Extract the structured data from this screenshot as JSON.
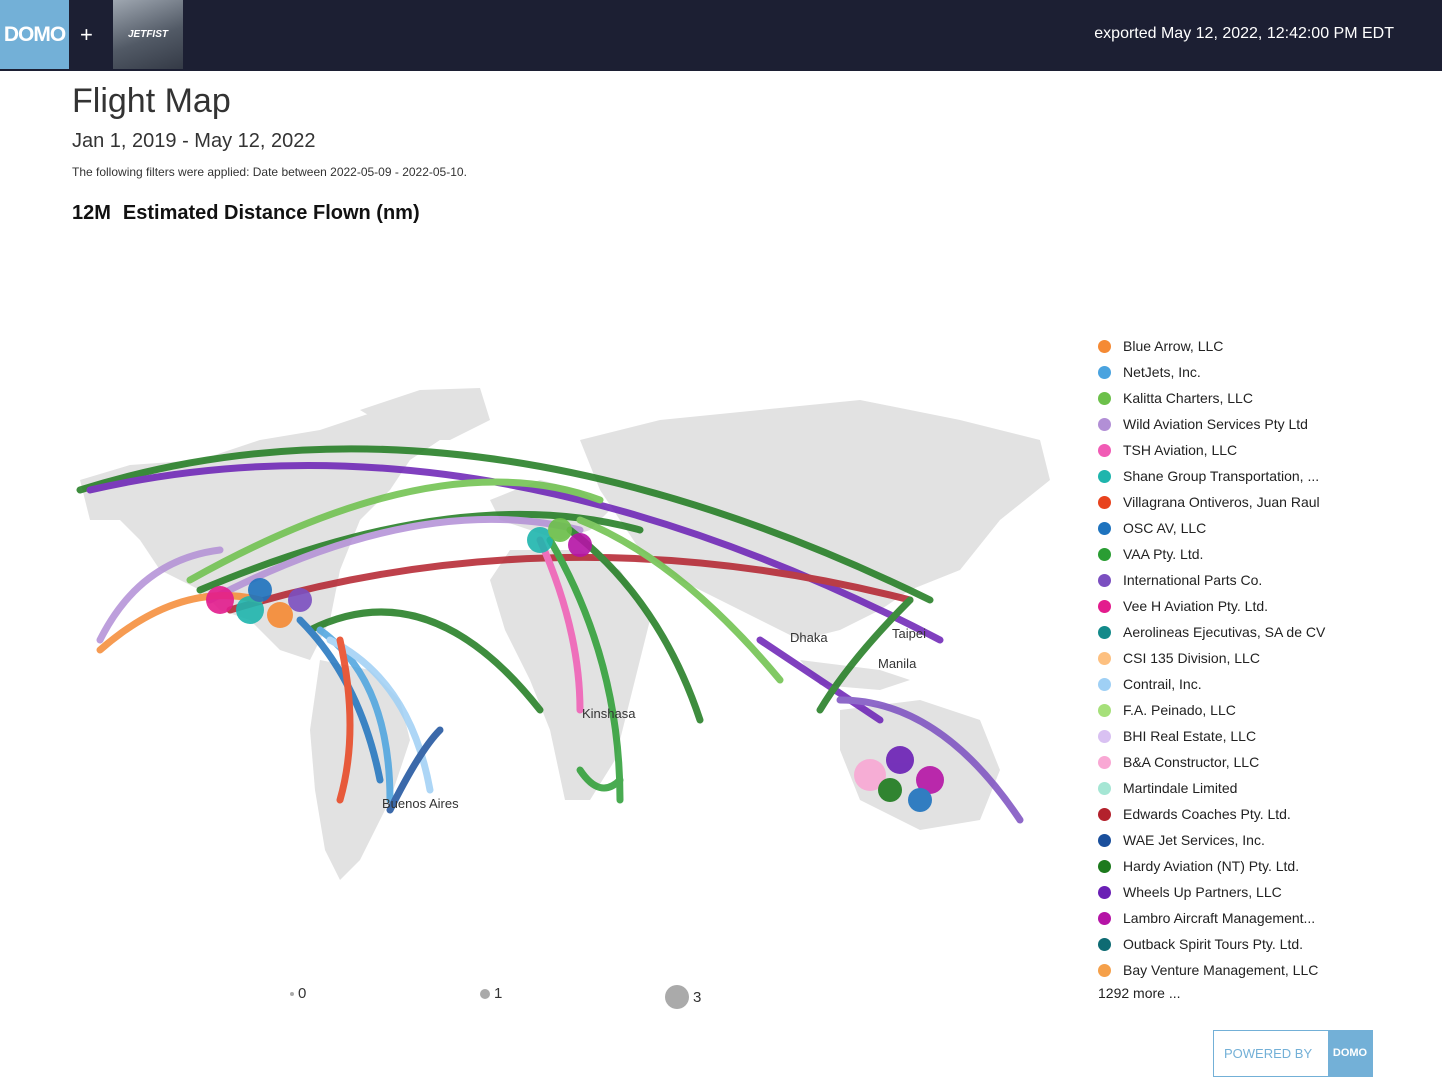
{
  "header": {
    "brand": "DOMO",
    "plus": "+",
    "partner_logo_text": "JETFIST",
    "exported_label": "exported May 12, 2022, 12:42:00 PM EDT"
  },
  "page": {
    "title": "Flight Map",
    "date_range": "Jan 1, 2019 - May 12, 2022",
    "filters_note": "The following filters were applied: Date between 2022-05-09 - 2022-05-10.",
    "summary_value": "12M",
    "summary_label": "Estimated Distance Flown (nm)"
  },
  "map": {
    "city_labels": [
      "Kinshasa",
      "Buenos Aires",
      "Dhaka",
      "Taipei",
      "Manila"
    ]
  },
  "legend": {
    "items": [
      {
        "label": "Blue Arrow, LLC",
        "color": "#f58a34"
      },
      {
        "label": "NetJets, Inc.",
        "color": "#4aa3df"
      },
      {
        "label": "Kalitta Charters, LLC",
        "color": "#6cc04a"
      },
      {
        "label": "Wild Aviation Services Pty Ltd",
        "color": "#b28fd6"
      },
      {
        "label": "TSH Aviation, LLC",
        "color": "#f15bb5"
      },
      {
        "label": "Shane Group Transportation, ...",
        "color": "#1fb5ad"
      },
      {
        "label": "Villagrana Ontiveros, Juan Raul",
        "color": "#e8431e"
      },
      {
        "label": "OSC AV, LLC",
        "color": "#1e73be"
      },
      {
        "label": "VAA Pty. Ltd.",
        "color": "#2a9d33"
      },
      {
        "label": "International Parts Co.",
        "color": "#7b4fc0"
      },
      {
        "label": "Vee H Aviation Pty. Ltd.",
        "color": "#e31c8d"
      },
      {
        "label": "Aerolineas Ejecutivas, SA de CV",
        "color": "#138a8a"
      },
      {
        "label": "CSI 135 Division, LLC",
        "color": "#fdc080"
      },
      {
        "label": "Contrail, Inc.",
        "color": "#9fd0f5"
      },
      {
        "label": "F.A. Peinado, LLC",
        "color": "#a6e07a"
      },
      {
        "label": "BHI Real Estate, LLC",
        "color": "#d9c1f2"
      },
      {
        "label": "B&A Constructor, LLC",
        "color": "#f9a8d4"
      },
      {
        "label": "Martindale Limited",
        "color": "#a5e6d4"
      },
      {
        "label": "Edwards Coaches Pty. Ltd.",
        "color": "#b3212c"
      },
      {
        "label": "WAE Jet Services, Inc.",
        "color": "#1a4f9c"
      },
      {
        "label": "Hardy Aviation (NT) Pty. Ltd.",
        "color": "#1d7a1d"
      },
      {
        "label": "Wheels Up Partners, LLC",
        "color": "#6a1fb5"
      },
      {
        "label": "Lambro Aircraft Management...",
        "color": "#b514a6"
      },
      {
        "label": "Outback Spirit Tours Pty. Ltd.",
        "color": "#0e6b73"
      },
      {
        "label": "Bay Venture Management, LLC",
        "color": "#f5a04a"
      }
    ],
    "more": "1292 more ..."
  },
  "size_legend": [
    {
      "label": "0"
    },
    {
      "label": "1"
    },
    {
      "label": "3"
    }
  ],
  "footer": {
    "powered_by": "POWERED BY",
    "logo": "DOMO"
  }
}
